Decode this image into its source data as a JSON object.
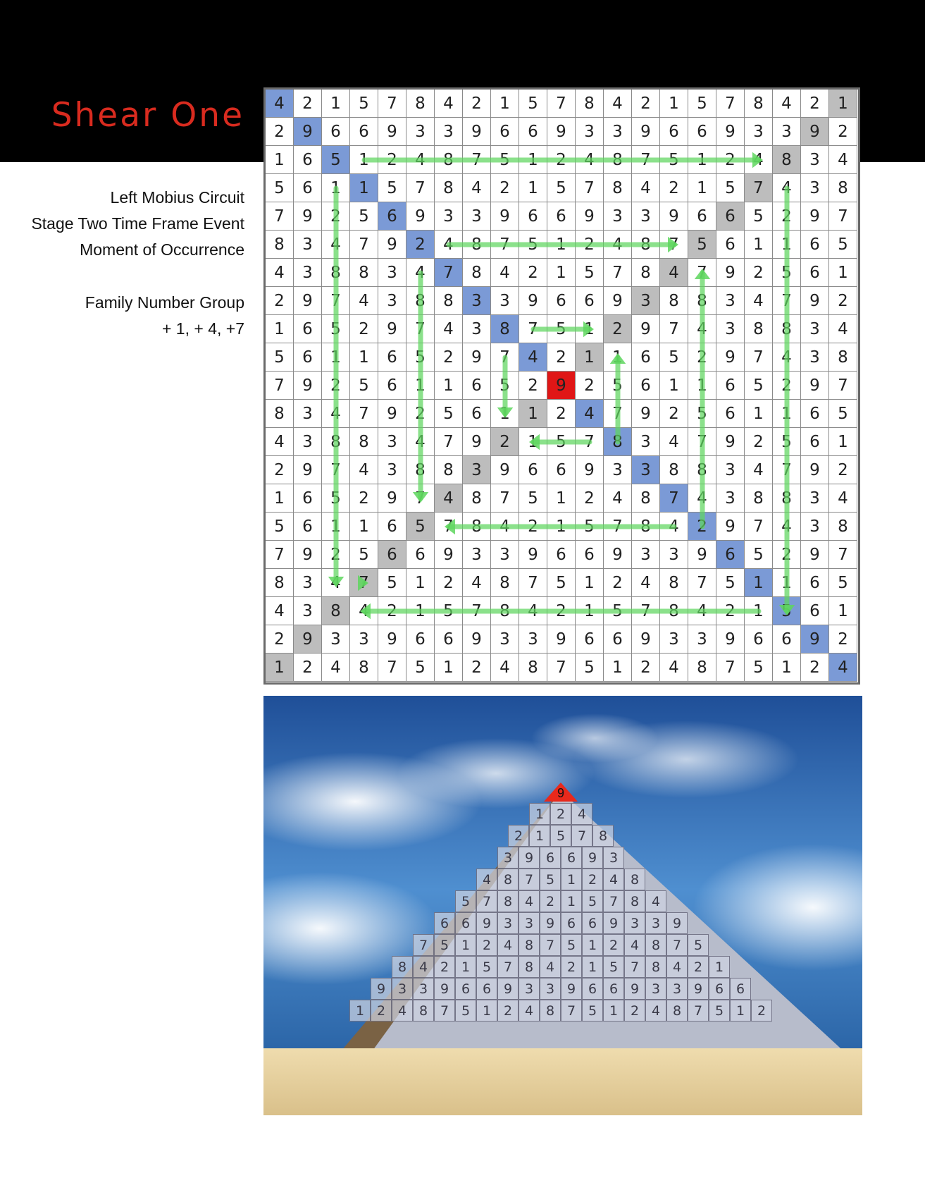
{
  "header": {
    "title": "Shear One"
  },
  "sidebar": {
    "lines": [
      "Left Mobius Circuit",
      "Stage Two Time Frame Event",
      "Moment  of Occurrence"
    ],
    "family_lines": [
      "Family Number Group",
      "+ 1, + 4, +7"
    ]
  },
  "grid": {
    "rows": [
      [
        "4",
        "2",
        "1",
        "5",
        "7",
        "8",
        "4",
        "2",
        "1",
        "5",
        "7",
        "8",
        "4",
        "2",
        "1",
        "5",
        "7",
        "8",
        "4",
        "2",
        "1"
      ],
      [
        "2",
        "9",
        "6",
        "6",
        "9",
        "3",
        "3",
        "9",
        "6",
        "6",
        "9",
        "3",
        "3",
        "9",
        "6",
        "6",
        "9",
        "3",
        "3",
        "9",
        "2"
      ],
      [
        "1",
        "6",
        "5",
        "1",
        "2",
        "4",
        "8",
        "7",
        "5",
        "1",
        "2",
        "4",
        "8",
        "7",
        "5",
        "1",
        "2",
        "4",
        "8",
        "3",
        "4"
      ],
      [
        "5",
        "6",
        "1",
        "1",
        "5",
        "7",
        "8",
        "4",
        "2",
        "1",
        "5",
        "7",
        "8",
        "4",
        "2",
        "1",
        "5",
        "7",
        "4",
        "3",
        "8"
      ],
      [
        "7",
        "9",
        "2",
        "5",
        "6",
        "9",
        "3",
        "3",
        "9",
        "6",
        "6",
        "9",
        "3",
        "3",
        "9",
        "6",
        "6",
        "5",
        "2",
        "9",
        "7"
      ],
      [
        "8",
        "3",
        "4",
        "7",
        "9",
        "2",
        "4",
        "8",
        "7",
        "5",
        "1",
        "2",
        "4",
        "8",
        "7",
        "5",
        "6",
        "1",
        "1",
        "6",
        "5"
      ],
      [
        "4",
        "3",
        "8",
        "8",
        "3",
        "4",
        "7",
        "8",
        "4",
        "2",
        "1",
        "5",
        "7",
        "8",
        "4",
        "7",
        "9",
        "2",
        "5",
        "6",
        "1"
      ],
      [
        "2",
        "9",
        "7",
        "4",
        "3",
        "8",
        "8",
        "3",
        "3",
        "9",
        "6",
        "6",
        "9",
        "3",
        "8",
        "8",
        "3",
        "4",
        "7",
        "9",
        "2"
      ],
      [
        "1",
        "6",
        "5",
        "2",
        "9",
        "7",
        "4",
        "3",
        "8",
        "7",
        "5",
        "1",
        "2",
        "9",
        "7",
        "4",
        "3",
        "8",
        "8",
        "3",
        "4"
      ],
      [
        "5",
        "6",
        "1",
        "1",
        "6",
        "5",
        "2",
        "9",
        "7",
        "4",
        "2",
        "1",
        "1",
        "6",
        "5",
        "2",
        "9",
        "7",
        "4",
        "3",
        "8"
      ],
      [
        "7",
        "9",
        "2",
        "5",
        "6",
        "1",
        "1",
        "6",
        "5",
        "2",
        "9",
        "2",
        "5",
        "6",
        "1",
        "1",
        "6",
        "5",
        "2",
        "9",
        "7"
      ],
      [
        "8",
        "3",
        "4",
        "7",
        "9",
        "2",
        "5",
        "6",
        "1",
        "1",
        "2",
        "4",
        "7",
        "9",
        "2",
        "5",
        "6",
        "1",
        "1",
        "6",
        "5"
      ],
      [
        "4",
        "3",
        "8",
        "8",
        "3",
        "4",
        "7",
        "9",
        "2",
        "1",
        "5",
        "7",
        "8",
        "3",
        "4",
        "7",
        "9",
        "2",
        "5",
        "6",
        "1"
      ],
      [
        "2",
        "9",
        "7",
        "4",
        "3",
        "8",
        "8",
        "3",
        "9",
        "6",
        "6",
        "9",
        "3",
        "3",
        "8",
        "8",
        "3",
        "4",
        "7",
        "9",
        "2"
      ],
      [
        "1",
        "6",
        "5",
        "2",
        "9",
        "7",
        "4",
        "8",
        "7",
        "5",
        "1",
        "2",
        "4",
        "8",
        "7",
        "4",
        "3",
        "8",
        "8",
        "3",
        "4"
      ],
      [
        "5",
        "6",
        "1",
        "1",
        "6",
        "5",
        "7",
        "8",
        "4",
        "2",
        "1",
        "5",
        "7",
        "8",
        "4",
        "2",
        "9",
        "7",
        "4",
        "3",
        "8"
      ],
      [
        "7",
        "9",
        "2",
        "5",
        "6",
        "6",
        "9",
        "3",
        "3",
        "9",
        "6",
        "6",
        "9",
        "3",
        "3",
        "9",
        "6",
        "5",
        "2",
        "9",
        "7"
      ],
      [
        "8",
        "3",
        "4",
        "7",
        "5",
        "1",
        "2",
        "4",
        "8",
        "7",
        "5",
        "1",
        "2",
        "4",
        "8",
        "7",
        "5",
        "1",
        "1",
        "6",
        "5"
      ],
      [
        "4",
        "3",
        "8",
        "4",
        "2",
        "1",
        "5",
        "7",
        "8",
        "4",
        "2",
        "1",
        "5",
        "7",
        "8",
        "4",
        "2",
        "1",
        "5",
        "6",
        "1"
      ],
      [
        "2",
        "9",
        "3",
        "3",
        "9",
        "6",
        "6",
        "9",
        "3",
        "3",
        "9",
        "6",
        "6",
        "9",
        "3",
        "3",
        "9",
        "6",
        "6",
        "9",
        "2"
      ],
      [
        "1",
        "2",
        "4",
        "8",
        "7",
        "5",
        "1",
        "2",
        "4",
        "8",
        "7",
        "5",
        "1",
        "2",
        "4",
        "8",
        "7",
        "5",
        "1",
        "2",
        "4"
      ]
    ],
    "blue_cells": [
      [
        0,
        0
      ],
      [
        1,
        1
      ],
      [
        2,
        2
      ],
      [
        3,
        3
      ],
      [
        4,
        4
      ],
      [
        5,
        5
      ],
      [
        6,
        6
      ],
      [
        7,
        7
      ],
      [
        8,
        8
      ],
      [
        9,
        9
      ],
      [
        11,
        11
      ],
      [
        12,
        12
      ],
      [
        13,
        13
      ],
      [
        14,
        14
      ],
      [
        15,
        15
      ],
      [
        16,
        16
      ],
      [
        17,
        17
      ],
      [
        18,
        18
      ],
      [
        19,
        19
      ],
      [
        20,
        20
      ]
    ],
    "gray_cells": [
      [
        0,
        20
      ],
      [
        1,
        19
      ],
      [
        2,
        18
      ],
      [
        3,
        17
      ],
      [
        4,
        16
      ],
      [
        5,
        15
      ],
      [
        6,
        14
      ],
      [
        7,
        13
      ],
      [
        8,
        12
      ],
      [
        9,
        11
      ],
      [
        11,
        9
      ],
      [
        12,
        8
      ],
      [
        13,
        7
      ],
      [
        14,
        6
      ],
      [
        15,
        5
      ],
      [
        16,
        4
      ],
      [
        17,
        3
      ],
      [
        18,
        2
      ],
      [
        19,
        1
      ],
      [
        20,
        0
      ]
    ],
    "red_cells": [
      [
        10,
        10
      ]
    ],
    "colors": {
      "blue": "#7b9ad6",
      "gray": "#bdbdbd",
      "red": "#e01616",
      "arrow": "#5ed65e"
    }
  },
  "pyramid": {
    "apex_label": "9",
    "rows": [
      [
        "1",
        "2",
        "4"
      ],
      [
        "2",
        "1",
        "5",
        "7",
        "8"
      ],
      [
        "3",
        "9",
        "6",
        "6",
        "9",
        "3"
      ],
      [
        "4",
        "8",
        "7",
        "5",
        "1",
        "2",
        "4",
        "8"
      ],
      [
        "5",
        "7",
        "8",
        "4",
        "2",
        "1",
        "5",
        "7",
        "8",
        "4"
      ],
      [
        "6",
        "6",
        "9",
        "3",
        "3",
        "9",
        "6",
        "6",
        "9",
        "3",
        "3",
        "9"
      ],
      [
        "7",
        "5",
        "1",
        "2",
        "4",
        "8",
        "7",
        "5",
        "1",
        "2",
        "4",
        "8",
        "7",
        "5"
      ],
      [
        "8",
        "4",
        "2",
        "1",
        "5",
        "7",
        "8",
        "4",
        "2",
        "1",
        "5",
        "7",
        "8",
        "4",
        "2",
        "1"
      ],
      [
        "9",
        "3",
        "3",
        "9",
        "6",
        "6",
        "9",
        "3",
        "3",
        "9",
        "6",
        "6",
        "9",
        "3",
        "3",
        "9",
        "6",
        "6"
      ],
      [
        "1",
        "2",
        "4",
        "8",
        "7",
        "5",
        "1",
        "2",
        "4",
        "8",
        "7",
        "5",
        "1",
        "2",
        "4",
        "8",
        "7",
        "5",
        "1",
        "2"
      ]
    ],
    "colors": {
      "apex": "#e8291c",
      "sky": "#2f6fb8",
      "sand": "#e6d2a3"
    }
  }
}
